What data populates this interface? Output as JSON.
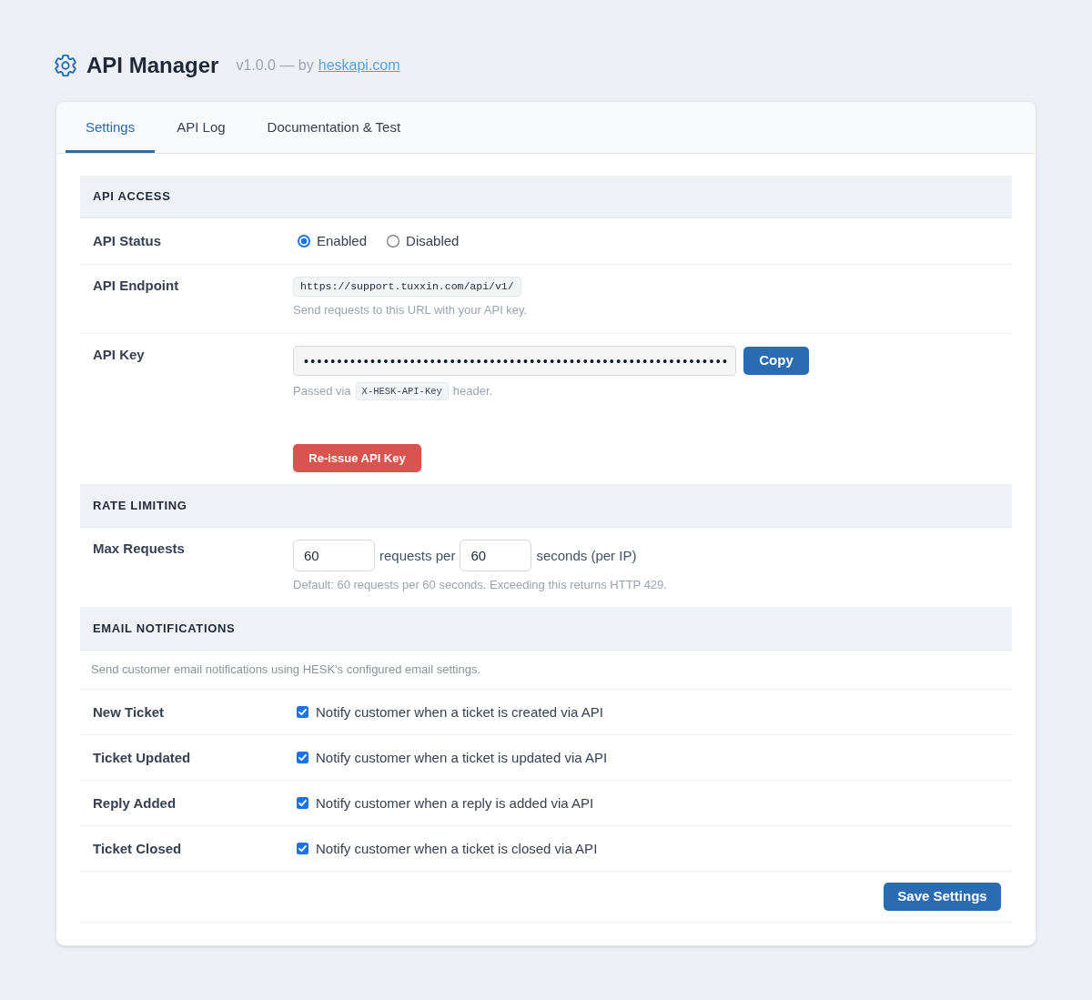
{
  "header": {
    "title": "API Manager",
    "version": "v1.0.0 — by",
    "link": "heskapi.com"
  },
  "tabs": [
    {
      "label": "Settings",
      "selected": true
    },
    {
      "label": "API Log",
      "selected": false
    },
    {
      "label": "Documentation & Test",
      "selected": false
    }
  ],
  "sections": [
    {
      "heading": "API ACCESS",
      "rows": [
        {
          "kind": "radio",
          "label": "API Status",
          "options": [
            {
              "label": "Enabled",
              "selected": true
            },
            {
              "label": "Disabled",
              "selected": false
            }
          ]
        },
        {
          "kind": "code",
          "label": "API Endpoint",
          "value": "https://support.tuxxin.com/api/v1/",
          "help": "Send requests to this URL with your API key."
        },
        {
          "kind": "secret",
          "label": "API Key",
          "value": "••••••••••••••••••••••••••••••••••••••••••••••••••••••••••••••••",
          "button": "Copy",
          "help_before": "Passed via",
          "help_code": "X-HESK-API-Key",
          "help_after": "header.",
          "action": "Re-issue API Key"
        }
      ]
    },
    {
      "heading": "RATE LIMITING",
      "rows": [
        {
          "kind": "rate",
          "label": "Max Requests",
          "requests": "60",
          "between": "requests per",
          "seconds": "60",
          "suffix": "seconds (per IP)",
          "help": "Default: 60 requests per 60 seconds. Exceeding this returns HTTP 429."
        }
      ]
    },
    {
      "heading": "EMAIL NOTIFICATIONS",
      "description": "Send customer email notifications using HESK's configured email settings.",
      "rows": [
        {
          "kind": "checkbox",
          "label": "New Ticket",
          "text": "Notify customer when a ticket is created via API",
          "checked": true
        },
        {
          "kind": "checkbox",
          "label": "Ticket Updated",
          "text": "Notify customer when a ticket is updated via API",
          "checked": true
        },
        {
          "kind": "checkbox",
          "label": "Reply Added",
          "text": "Notify customer when a reply is added via API",
          "checked": true
        },
        {
          "kind": "checkbox",
          "label": "Ticket Closed",
          "text": "Notify customer when a ticket is closed via API",
          "checked": true
        }
      ]
    }
  ],
  "save_button": "Save Settings"
}
